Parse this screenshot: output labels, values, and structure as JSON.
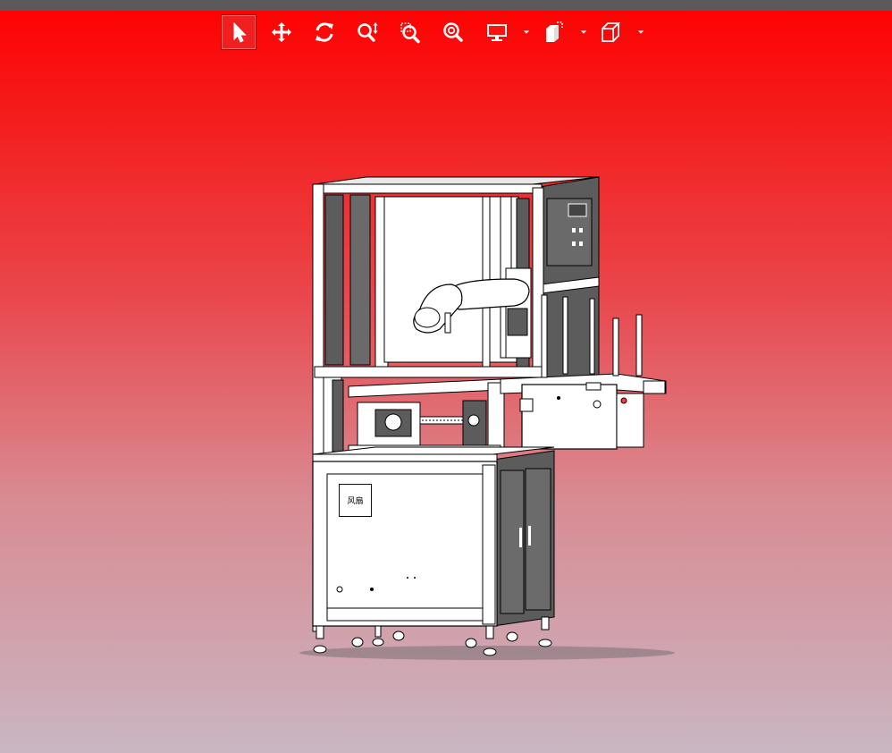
{
  "toolbar": {
    "tools": [
      {
        "id": "select",
        "icon": "cursor-icon",
        "active": true
      },
      {
        "id": "pan",
        "icon": "move-icon",
        "active": false
      },
      {
        "id": "rotate",
        "icon": "rotate-icon",
        "active": false
      },
      {
        "id": "zoom",
        "icon": "zoom-updown-icon",
        "active": false
      },
      {
        "id": "zoom-window",
        "icon": "zoom-window-icon",
        "active": false
      },
      {
        "id": "zoom-fit",
        "icon": "zoom-fit-icon",
        "active": false
      },
      {
        "id": "display-mode",
        "icon": "monitor-icon",
        "dropdown": true
      },
      {
        "id": "section-view",
        "icon": "section-icon",
        "dropdown": true
      },
      {
        "id": "view-orientation",
        "icon": "cube-icon",
        "dropdown": true
      }
    ]
  },
  "model": {
    "panel_label": "风扇"
  },
  "colors": {
    "accent_red": "#ff0000",
    "icon_white": "#ffffff",
    "machine_gray": "#5c5c5c"
  }
}
